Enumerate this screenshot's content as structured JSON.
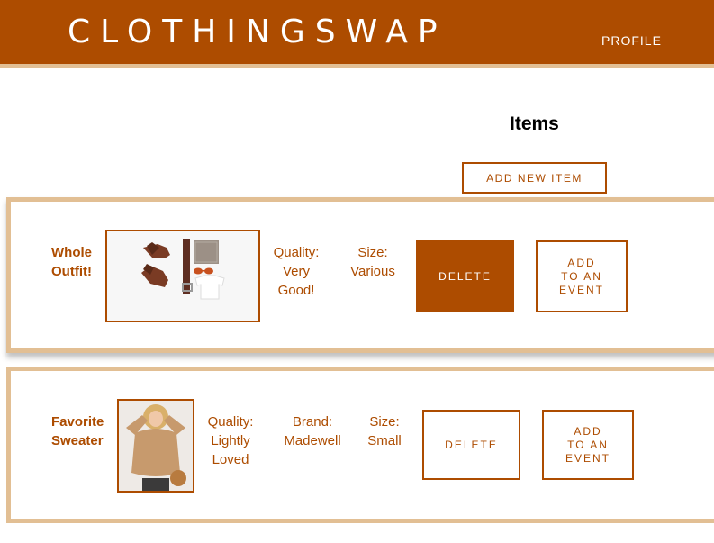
{
  "header": {
    "brand": "CLOTHINGSWAP",
    "profile_link": "PROFILE"
  },
  "page": {
    "title": "Items",
    "add_new_label": "ADD NEW ITEM"
  },
  "items": [
    {
      "name_line1": "Whole",
      "name_line2": "Outfit!",
      "image_icon": "outfit-flatlay-photo",
      "quality_label": "Quality:",
      "quality_line1": "Very",
      "quality_line2": "Good!",
      "size_label": "Size:",
      "size_value": "Various",
      "delete_label": "DELETE",
      "event_line1": "ADD",
      "event_line2": "TO AN",
      "event_line3": "EVENT"
    },
    {
      "name_line1": "Favorite",
      "name_line2": "Sweater",
      "image_icon": "sweater-model-photo",
      "quality_label": "Quality:",
      "quality_line1": "Lightly",
      "quality_line2": "Loved",
      "brand_label": "Brand:",
      "brand_value": "Madewell",
      "size_label": "Size:",
      "size_value": "Small",
      "delete_label": "DELETE",
      "event_line1": "ADD",
      "event_line2": "TO AN",
      "event_line3": "EVENT"
    }
  ],
  "colors": {
    "brand": "#ad4c00",
    "accent": "#e2bf94"
  }
}
